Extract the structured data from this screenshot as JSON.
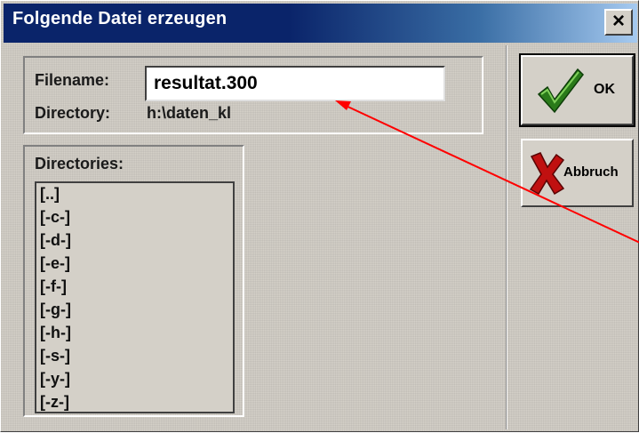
{
  "dialog": {
    "title": "Folgende Datei erzeugen",
    "close_label": "×"
  },
  "file": {
    "filename_label": "Filename:",
    "filename_value": "resultat.300",
    "directory_label": "Directory:",
    "directory_value": "h:\\daten_kl"
  },
  "directories": {
    "label": "Directories:",
    "items": [
      "[..]",
      "[-c-]",
      "[-d-]",
      "[-e-]",
      "[-f-]",
      "[-g-]",
      "[-h-]",
      "[-s-]",
      "[-y-]",
      "[-z-]"
    ]
  },
  "buttons": {
    "ok_label": "OK",
    "cancel_label": "Abbruch"
  },
  "colors": {
    "title_bar": "#0a246a",
    "annotation_arrow": "#ff0000",
    "ok_check": "#2a7a1a",
    "cancel_x": "#c01010"
  },
  "icons": {
    "ok": "green-checkmark-icon",
    "cancel": "red-x-icon"
  }
}
